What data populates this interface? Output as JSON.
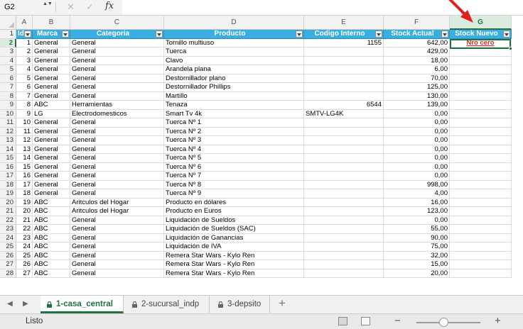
{
  "formula_bar": {
    "name_box": "G2",
    "stepper_glyph": "▲▼",
    "cancel_glyph": "✕",
    "enter_glyph": "✓",
    "fx_label": "fx",
    "formula": ""
  },
  "accent_color": "#217346",
  "header_color": "#3aaee0",
  "annotation_color": "#e02020",
  "columns": [
    "A",
    "B",
    "C",
    "D",
    "E",
    "F",
    "G"
  ],
  "headers": [
    "Id",
    "Marca",
    "Categoria",
    "Producto",
    "Codigo Interno",
    "Stock Actual",
    "Stock Nuevo"
  ],
  "active_cell_value": "Nro cero",
  "rows": [
    [
      "1",
      "General",
      "General",
      "Tornillo multiuso",
      "1155",
      "642,00"
    ],
    [
      "2",
      "General",
      "General",
      "Tuerca",
      "",
      "429,00"
    ],
    [
      "3",
      "General",
      "General",
      "Clavo",
      "",
      "18,00"
    ],
    [
      "4",
      "General",
      "General",
      "Arandela plana",
      "",
      "6,00"
    ],
    [
      "5",
      "General",
      "General",
      "Destornillador plano",
      "",
      "70,00"
    ],
    [
      "6",
      "General",
      "General",
      "Destornillador Phillips",
      "",
      "125,00"
    ],
    [
      "7",
      "General",
      "General",
      "Martillo",
      "",
      "130,00"
    ],
    [
      "8",
      "ABC",
      "Herramientas",
      "Tenaza",
      "6544",
      "139,00"
    ],
    [
      "9",
      "LG",
      "Electrodomesticos",
      "Smart Tv 4k",
      "SMTV-LG4K",
      "0,00"
    ],
    [
      "10",
      "General",
      "General",
      "Tuerca Nº 1",
      "",
      "0,00"
    ],
    [
      "11",
      "General",
      "General",
      "Tuerca Nº 2",
      "",
      "0,00"
    ],
    [
      "12",
      "General",
      "General",
      "Tuerca Nº 3",
      "",
      "0,00"
    ],
    [
      "13",
      "General",
      "General",
      "Tuerca Nº 4",
      "",
      "0,00"
    ],
    [
      "14",
      "General",
      "General",
      "Tuerca Nº 5",
      "",
      "0,00"
    ],
    [
      "15",
      "General",
      "General",
      "Tuerca Nº 6",
      "",
      "0,00"
    ],
    [
      "16",
      "General",
      "General",
      "Tuerca Nº 7",
      "",
      "0,00"
    ],
    [
      "17",
      "General",
      "General",
      "Tuerca Nº 8",
      "",
      "998,00"
    ],
    [
      "18",
      "General",
      "General",
      "Tuerca Nº 9",
      "",
      "4,00"
    ],
    [
      "19",
      "ABC",
      "Aritculos del Hogar",
      "Producto en dólares",
      "",
      "16,00"
    ],
    [
      "20",
      "ABC",
      "Aritculos del Hogar",
      "Producto en Euros",
      "",
      "123,00"
    ],
    [
      "21",
      "ABC",
      "General",
      "Liquidación de Sueldos",
      "",
      "0,00"
    ],
    [
      "22",
      "ABC",
      "General",
      "Liquidación de Sueldos (SAC)",
      "",
      "55,00"
    ],
    [
      "23",
      "ABC",
      "General",
      "Liquidación de Ganancias",
      "",
      "90,00"
    ],
    [
      "24",
      "ABC",
      "General",
      "Liquidación de IVA",
      "",
      "75,00"
    ],
    [
      "25",
      "ABC",
      "General",
      "Remera Star Wars - Kylo Ren",
      "",
      "32,00"
    ],
    [
      "26",
      "ABC",
      "General",
      "Remera Star Wars - Kylo Ren",
      "",
      "15,00"
    ],
    [
      "27",
      "ABC",
      "General",
      "Remera Star Wars - Kylo Ren",
      "",
      "20,00"
    ]
  ],
  "sheet_nav": {
    "prev": "◀",
    "next": "▶",
    "add": "+"
  },
  "sheets": [
    {
      "name": "1-casa_central",
      "active": true
    },
    {
      "name": "2-sucursal_indp",
      "active": false
    },
    {
      "name": "3-depsito",
      "active": false
    }
  ],
  "status": {
    "text": "Listo",
    "zoom_minus": "−",
    "zoom_plus": "+",
    "zoom_fraction": 0.42
  }
}
